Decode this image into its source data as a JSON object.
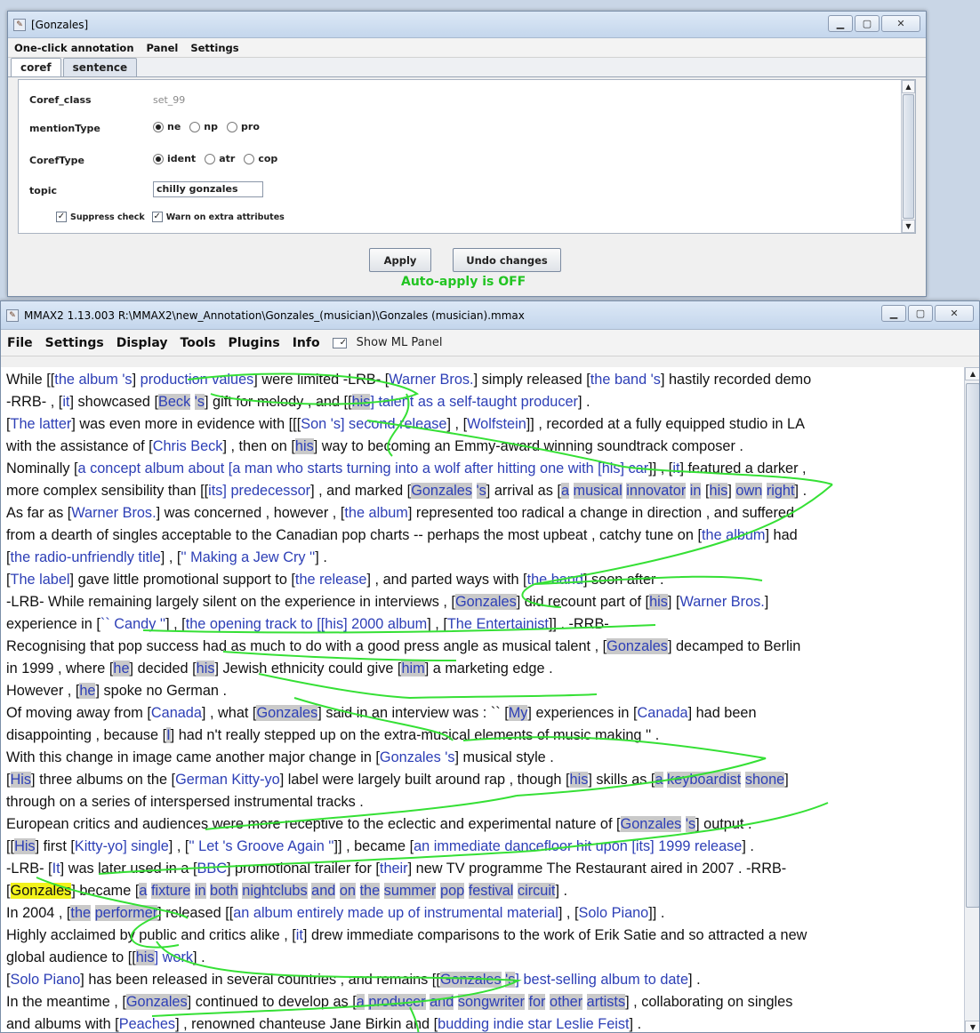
{
  "top_window": {
    "title": "[Gonzales]",
    "menu": [
      "One-click annotation",
      "Panel",
      "Settings"
    ],
    "tabs": [
      "coref",
      "sentence"
    ],
    "fields": {
      "coref_class_label": "Coref_class",
      "coref_class_value": "set_99",
      "mention_type_label": "mentionType",
      "mention_type_options": [
        "ne",
        "np",
        "pro"
      ],
      "mention_type_selected": "ne",
      "coref_type_label": "CorefType",
      "coref_type_options": [
        "ident",
        "atr",
        "cop"
      ],
      "coref_type_selected": "ident",
      "topic_label": "topic",
      "topic_value": "chilly gonzales"
    },
    "checkboxes": {
      "suppress_check": "Suppress check",
      "warn_extra": "Warn on extra attributes"
    },
    "buttons": {
      "apply": "Apply",
      "undo": "Undo changes"
    },
    "status": "Auto-apply is OFF"
  },
  "main_window": {
    "title": "MMAX2 1.13.003 R:\\MMAX2\\new_Annotation\\Gonzales_(musician)\\Gonzales (musician).mmax",
    "menu": [
      "File",
      "Settings",
      "Display",
      "Tools",
      "Plugins",
      "Info"
    ],
    "show_ml_panel": "Show ML Panel",
    "text_lines": [
      [
        [
          "While [[",
          "t"
        ],
        [
          "the album 's",
          "m"
        ],
        [
          "] ",
          "t"
        ],
        [
          "production values",
          "m"
        ],
        [
          "] were limited -LRB- [",
          "t"
        ],
        [
          "Warner Bros.",
          "m"
        ],
        [
          "] simply released [",
          "t"
        ],
        [
          "the band 's",
          "m"
        ],
        [
          "] hastily recorded demo",
          "t"
        ]
      ],
      [
        [
          "-RRB- , [",
          "t"
        ],
        [
          "it",
          "m"
        ],
        [
          "] showcased [",
          "t"
        ],
        [
          "Beck",
          "mh"
        ],
        [
          " ",
          "t"
        ],
        [
          "'s",
          "mh"
        ],
        [
          "] gift for melody , and [[",
          "t"
        ],
        [
          "his",
          "mh"
        ],
        [
          "] talent as a self-taught producer",
          "m"
        ],
        [
          "] .",
          "t"
        ]
      ],
      [
        [
          "[",
          "t"
        ],
        [
          "The latter",
          "m"
        ],
        [
          "] was even more in evidence with [[[",
          "t"
        ],
        [
          "Son",
          "m"
        ],
        [
          " 's",
          "m"
        ],
        [
          "] second release",
          "m"
        ],
        [
          "] , [",
          "t"
        ],
        [
          "Wolfstein",
          "m"
        ],
        [
          "]] , recorded at a fully equipped studio in LA",
          "t"
        ]
      ],
      [
        [
          "with the assistance of [",
          "t"
        ],
        [
          "Chris Beck",
          "m"
        ],
        [
          "] , then on [",
          "t"
        ],
        [
          "his",
          "mh"
        ],
        [
          "] way to becoming an Emmy-award winning soundtrack composer .",
          "t"
        ]
      ],
      [
        [
          "Nominally [",
          "t"
        ],
        [
          "a concept album about [a man who starts turning into a wolf after hitting one with [his] car",
          "m"
        ],
        [
          "]] , [",
          "t"
        ],
        [
          "it",
          "m"
        ],
        [
          "] featured a darker ,",
          "t"
        ]
      ],
      [
        [
          "more complex sensibility than [[",
          "t"
        ],
        [
          "its",
          "m"
        ],
        [
          "] predecessor",
          "m"
        ],
        [
          "] , and marked [",
          "t"
        ],
        [
          "Gonzales",
          "mh"
        ],
        [
          " ",
          "t"
        ],
        [
          "'s",
          "mh"
        ],
        [
          "] arrival as [",
          "t"
        ],
        [
          "a",
          "mh"
        ],
        [
          " ",
          "t"
        ],
        [
          "musical",
          "mh"
        ],
        [
          " ",
          "t"
        ],
        [
          "innovator",
          "mh"
        ],
        [
          " ",
          "t"
        ],
        [
          "in",
          "mh"
        ],
        [
          " [",
          "t"
        ],
        [
          "his",
          "mh"
        ],
        [
          "] ",
          "t"
        ],
        [
          "own",
          "mh"
        ],
        [
          " ",
          "t"
        ],
        [
          "right",
          "mh"
        ],
        [
          "] .",
          "t"
        ]
      ],
      [
        [
          "As far as [",
          "t"
        ],
        [
          "Warner Bros.",
          "m"
        ],
        [
          "] was concerned , however , [",
          "t"
        ],
        [
          "the album",
          "m"
        ],
        [
          "] represented too radical a change in direction , and suffered",
          "t"
        ]
      ],
      [
        [
          "from a dearth of singles acceptable to the Canadian pop charts -- perhaps the most upbeat , catchy tune on [",
          "t"
        ],
        [
          "the album",
          "m"
        ],
        [
          "] had",
          "t"
        ]
      ],
      [
        [
          "[",
          "t"
        ],
        [
          "the radio-unfriendly title",
          "m"
        ],
        [
          "] , [",
          "t"
        ],
        [
          "'' Making a Jew Cry ''",
          "m"
        ],
        [
          "] .",
          "t"
        ]
      ],
      [
        [
          "[",
          "t"
        ],
        [
          "The label",
          "m"
        ],
        [
          "] gave little promotional support to [",
          "t"
        ],
        [
          "the release",
          "m"
        ],
        [
          "] , and parted ways with [",
          "t"
        ],
        [
          "the band",
          "m"
        ],
        [
          "] soon after .",
          "t"
        ]
      ],
      [
        [
          "-LRB- While remaining largely silent on the experience in interviews , [",
          "t"
        ],
        [
          "Gonzales",
          "mh"
        ],
        [
          "] did recount part of [",
          "t"
        ],
        [
          "his",
          "mh"
        ],
        [
          "] [",
          "t"
        ],
        [
          "Warner Bros.",
          "m"
        ],
        [
          "]",
          "t"
        ]
      ],
      [
        [
          "experience in [",
          "t"
        ],
        [
          "`` Candy ''",
          "m"
        ],
        [
          "] , [",
          "t"
        ],
        [
          "the opening track to [[his] 2000 album",
          "m"
        ],
        [
          "] , [",
          "t"
        ],
        [
          "The Entertainist",
          "m"
        ],
        [
          "]] . -RRB-",
          "t"
        ]
      ],
      [
        [
          "Recognising that pop success had as much to do with a good press angle as musical talent , [",
          "t"
        ],
        [
          "Gonzales",
          "mh"
        ],
        [
          "] decamped to Berlin",
          "t"
        ]
      ],
      [
        [
          "in 1999 , where [",
          "t"
        ],
        [
          "he",
          "mh"
        ],
        [
          "] decided [",
          "t"
        ],
        [
          "his",
          "mh"
        ],
        [
          "] Jewish ethnicity could give [",
          "t"
        ],
        [
          "him",
          "mh"
        ],
        [
          "] a marketing edge .",
          "t"
        ]
      ],
      [
        [
          "However , [",
          "t"
        ],
        [
          "he",
          "mh"
        ],
        [
          "] spoke no German .",
          "t"
        ]
      ],
      [
        [
          "Of moving away from [",
          "t"
        ],
        [
          "Canada",
          "m"
        ],
        [
          "] , what [",
          "t"
        ],
        [
          "Gonzales",
          "mh"
        ],
        [
          "] said in an interview was : `` [",
          "t"
        ],
        [
          "My",
          "mh"
        ],
        [
          "] experiences in [",
          "t"
        ],
        [
          "Canada",
          "m"
        ],
        [
          "] had been",
          "t"
        ]
      ],
      [
        [
          "disappointing , because [",
          "t"
        ],
        [
          "I",
          "mh"
        ],
        [
          "] had n't really stepped up on the extra-musical elements of music making '' .",
          "t"
        ]
      ],
      [
        [
          "With this change in image came another major change in [",
          "t"
        ],
        [
          "Gonzales",
          "m"
        ],
        [
          " 's",
          "m"
        ],
        [
          "] musical style .",
          "t"
        ]
      ],
      [
        [
          "[",
          "t"
        ],
        [
          "His",
          "mh"
        ],
        [
          "] three albums on the [",
          "t"
        ],
        [
          "German Kitty-yo",
          "m"
        ],
        [
          "] label were largely built around rap , though [",
          "t"
        ],
        [
          "his",
          "mh"
        ],
        [
          "] skills as [",
          "t"
        ],
        [
          "a",
          "mh"
        ],
        [
          " ",
          "t"
        ],
        [
          "keyboardist",
          "mh"
        ],
        [
          " ",
          "t"
        ],
        [
          "shone",
          "mh"
        ],
        [
          "]",
          "t"
        ]
      ],
      [
        [
          "through on a series of interspersed instrumental tracks .",
          "t"
        ]
      ],
      [
        [
          "European critics and audiences were more receptive to the eclectic and experimental nature of [",
          "t"
        ],
        [
          "Gonzales",
          "mh"
        ],
        [
          " ",
          "t"
        ],
        [
          "'s",
          "mh"
        ],
        [
          "] output .",
          "t"
        ]
      ],
      [
        [
          "[[",
          "t"
        ],
        [
          "His",
          "mh"
        ],
        [
          "] first [",
          "t"
        ],
        [
          "Kitty-yo",
          "m"
        ],
        [
          "] single",
          "m"
        ],
        [
          "] , [",
          "t"
        ],
        [
          "'' Let 's Groove Again ''",
          "m"
        ],
        [
          "]] , became [",
          "t"
        ],
        [
          "an immediate dancefloor hit upon [its] 1999 release",
          "m"
        ],
        [
          "] .",
          "t"
        ]
      ],
      [
        [
          "-LRB- [",
          "t"
        ],
        [
          "It",
          "m"
        ],
        [
          "] was later used in a [",
          "t"
        ],
        [
          "BBC",
          "m"
        ],
        [
          "] promotional trailer for [",
          "t"
        ],
        [
          "their",
          "m"
        ],
        [
          "] new TV programme The Restaurant aired in 2007 . -RRB-",
          "t"
        ]
      ],
      [
        [
          "[",
          "t"
        ],
        [
          "Gonzales",
          "y"
        ],
        [
          "] became [",
          "t"
        ],
        [
          "a",
          "mh"
        ],
        [
          " ",
          "t"
        ],
        [
          "fixture",
          "mh"
        ],
        [
          " ",
          "t"
        ],
        [
          "in",
          "mh"
        ],
        [
          " ",
          "t"
        ],
        [
          "both",
          "mh"
        ],
        [
          " ",
          "t"
        ],
        [
          "nightclubs",
          "mh"
        ],
        [
          " ",
          "t"
        ],
        [
          "and",
          "mh"
        ],
        [
          " ",
          "t"
        ],
        [
          "on",
          "mh"
        ],
        [
          " ",
          "t"
        ],
        [
          "the",
          "mh"
        ],
        [
          " ",
          "t"
        ],
        [
          "summer",
          "mh"
        ],
        [
          " ",
          "t"
        ],
        [
          "pop",
          "mh"
        ],
        [
          " ",
          "t"
        ],
        [
          "festival",
          "mh"
        ],
        [
          " ",
          "t"
        ],
        [
          "circuit",
          "mh"
        ],
        [
          "] .",
          "t"
        ]
      ],
      [
        [
          "In 2004 , [",
          "t"
        ],
        [
          "the",
          "mh"
        ],
        [
          " ",
          "t"
        ],
        [
          "performer",
          "mh"
        ],
        [
          "] released [[",
          "t"
        ],
        [
          "an album entirely made up of instrumental material",
          "m"
        ],
        [
          "] , [",
          "t"
        ],
        [
          "Solo Piano",
          "m"
        ],
        [
          "]] .",
          "t"
        ]
      ],
      [
        [
          "Highly acclaimed by public and critics alike , [",
          "t"
        ],
        [
          "it",
          "m"
        ],
        [
          "] drew immediate comparisons to the work of Erik Satie and so attracted a new",
          "t"
        ]
      ],
      [
        [
          "global audience to [[",
          "t"
        ],
        [
          "his",
          "mh"
        ],
        [
          "] work",
          "m"
        ],
        [
          "] .",
          "t"
        ]
      ],
      [
        [
          "[",
          "t"
        ],
        [
          "Solo Piano",
          "m"
        ],
        [
          "] has been released in several countries , and remains [[",
          "t"
        ],
        [
          "Gonzales",
          "mh"
        ],
        [
          " ",
          "t"
        ],
        [
          "'s",
          "mh"
        ],
        [
          "] best-selling album to date",
          "m"
        ],
        [
          "] .",
          "t"
        ]
      ],
      [
        [
          "In the meantime , [",
          "t"
        ],
        [
          "Gonzales",
          "mh"
        ],
        [
          "] continued to develop as [",
          "t"
        ],
        [
          "a",
          "mh"
        ],
        [
          " ",
          "t"
        ],
        [
          "producer",
          "mh"
        ],
        [
          " ",
          "t"
        ],
        [
          "and",
          "mh"
        ],
        [
          " ",
          "t"
        ],
        [
          "songwriter",
          "mh"
        ],
        [
          " ",
          "t"
        ],
        [
          "for",
          "mh"
        ],
        [
          " ",
          "t"
        ],
        [
          "other",
          "mh"
        ],
        [
          " ",
          "t"
        ],
        [
          "artists",
          "mh"
        ],
        [
          "] , collaborating on singles",
          "t"
        ]
      ],
      [
        [
          "and albums with [",
          "t"
        ],
        [
          "Peaches",
          "m"
        ],
        [
          "] , renowned chanteuse Jane Birkin and [",
          "t"
        ],
        [
          "budding indie star Leslie Feist",
          "m"
        ],
        [
          "] .",
          "t"
        ]
      ]
    ]
  }
}
